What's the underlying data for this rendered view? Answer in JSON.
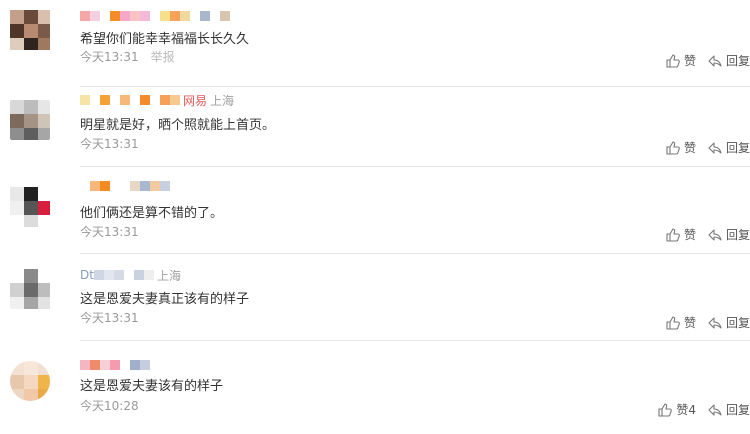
{
  "comments": [
    {
      "content": "希望你们能幸幸福福长长久久",
      "time": "今天13:31",
      "report": "举报",
      "name_text": "",
      "location": "",
      "like_label": "赞",
      "reply_label": "回复"
    },
    {
      "content": "明星就是好，晒个照就能上首页。",
      "time": "今天13:31",
      "report": "",
      "name_text": "网易",
      "location": "上海",
      "like_label": "赞",
      "reply_label": "回复"
    },
    {
      "content": "他们俩还是算不错的了。",
      "time": "今天13:31",
      "report": "",
      "name_text": "",
      "location": "",
      "like_label": "赞",
      "reply_label": "回复"
    },
    {
      "content": "这是恩爱夫妻真正该有的样子",
      "time": "今天13:31",
      "report": "",
      "name_text": "Dt",
      "location": "上海",
      "like_label": "赞",
      "reply_label": "回复"
    },
    {
      "content": "这是恩爱夫妻该有的样子",
      "time": "今天10:28",
      "report": "",
      "name_text": "",
      "location": "",
      "like_label": "赞4",
      "reply_label": "回复"
    }
  ],
  "icons": {
    "like": "thumbs-up-icon",
    "reply": "reply-arrow-icon"
  }
}
